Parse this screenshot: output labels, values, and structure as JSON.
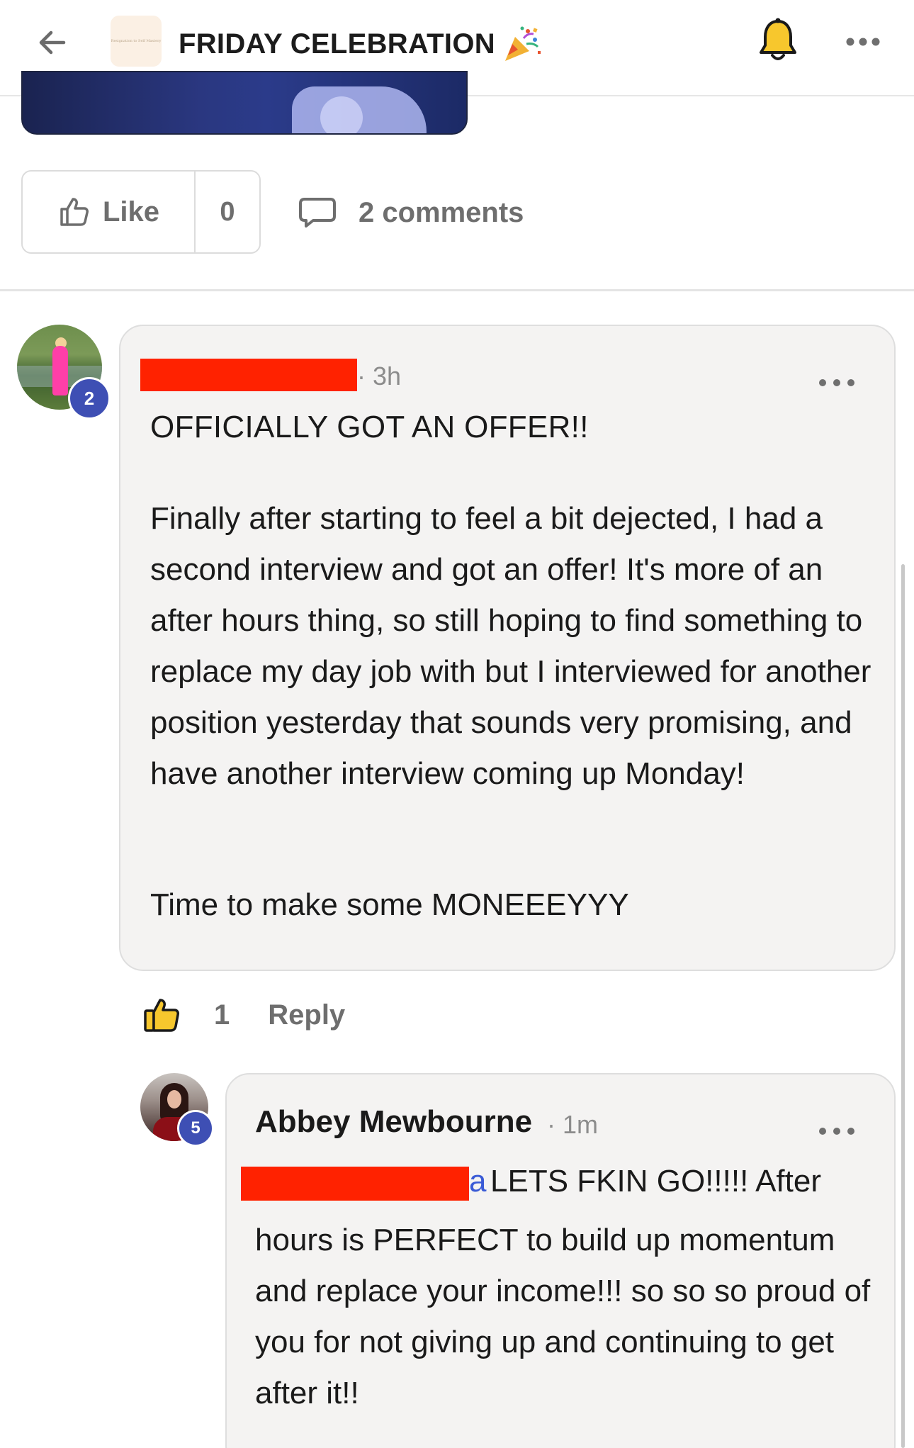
{
  "header": {
    "title": "FRIDAY CELEBRATION",
    "logo_text": "Resignation to Self Mastery"
  },
  "post": {
    "like_label": "Like",
    "like_count": "0",
    "comments_label": "2 comments"
  },
  "comments": [
    {
      "time": "3h",
      "avatar_badge": "2",
      "title": "OFFICIALLY GOT AN OFFER!!",
      "body": "Finally after starting to feel a bit dejected, I had a second interview and got an offer! It's more of an after hours thing, so still hoping to find something to replace my day job with but I interviewed for another position yesterday that sounds very promising, and have another interview coming up Monday!",
      "closing": "Time to make some MONEEEYYY",
      "reaction_count": "1",
      "reply_label": "Reply"
    },
    {
      "author": "Abbey Mewbourne",
      "time": "1m",
      "avatar_badge": "5",
      "mention_tail": "a",
      "first_line": "LETS FKIN GO!!!!! After",
      "body": "hours is PERFECT to build up momentum and replace your income!!! so so so proud of you for not giving up and continuing to get after it!!"
    }
  ],
  "colors": {
    "accent_badge": "#3e4fb4",
    "redaction": "#ff2200",
    "muted_text": "#6e6e6e",
    "bubble_bg": "#f4f3f2"
  }
}
